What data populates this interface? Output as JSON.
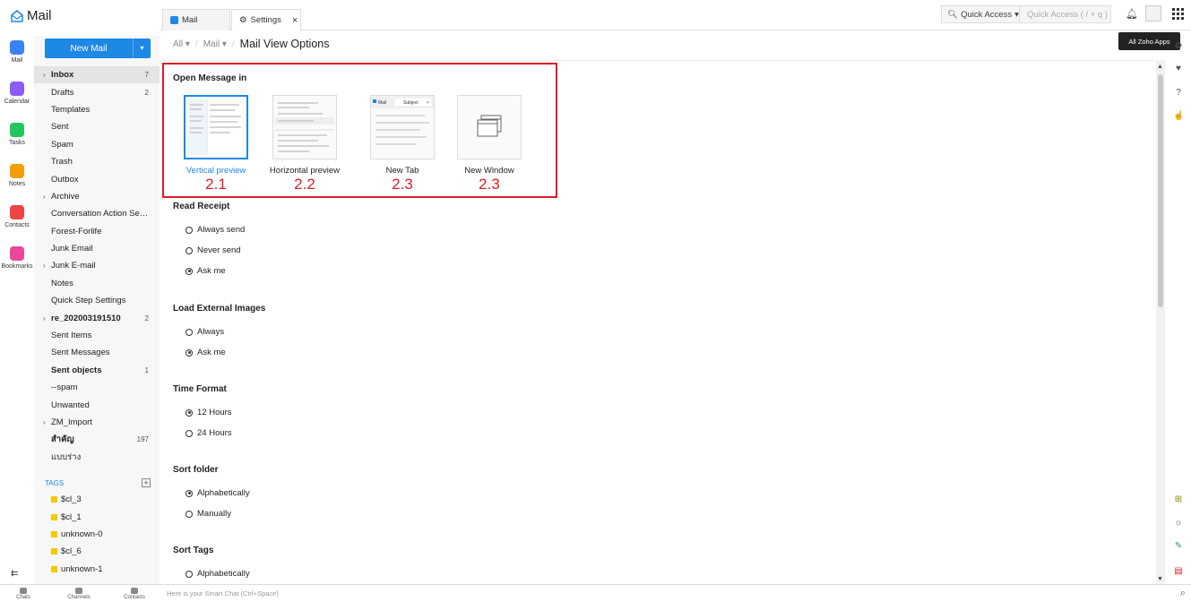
{
  "app": {
    "title": "Mail",
    "accent": "#1e88e5",
    "highlight": "#e01b24"
  },
  "rail": [
    {
      "label": "Mail",
      "icon": "mail-icon",
      "color": "#3b82f6"
    },
    {
      "label": "Calendar",
      "icon": "calendar-icon",
      "color": "#8b5cf6"
    },
    {
      "label": "Tasks",
      "icon": "tasks-icon",
      "color": "#22c55e"
    },
    {
      "label": "Notes",
      "icon": "notes-icon",
      "color": "#f59e0b"
    },
    {
      "label": "Contacts",
      "icon": "contacts-icon",
      "color": "#ef4444"
    },
    {
      "label": "Bookmarks",
      "icon": "bookmarks-icon",
      "color": "#ec4899"
    }
  ],
  "new_mail": {
    "label": "New Mail"
  },
  "folders": [
    {
      "label": "Inbox",
      "count": "7",
      "caret": "›",
      "bold": true,
      "selected": true
    },
    {
      "label": "Drafts",
      "count": "2",
      "caret": "",
      "bold": false,
      "selected": false
    },
    {
      "label": "Templates",
      "count": "",
      "caret": "",
      "bold": false,
      "selected": false
    },
    {
      "label": "Sent",
      "count": "",
      "caret": "",
      "bold": false,
      "selected": false
    },
    {
      "label": "Spam",
      "count": "",
      "caret": "",
      "bold": false,
      "selected": false
    },
    {
      "label": "Trash",
      "count": "",
      "caret": "",
      "bold": false,
      "selected": false
    },
    {
      "label": "Outbox",
      "count": "",
      "caret": "",
      "bold": false,
      "selected": false
    },
    {
      "label": "Archive",
      "count": "",
      "caret": "›",
      "bold": false,
      "selected": false
    },
    {
      "label": "Conversation Action Sett...",
      "count": "",
      "caret": "",
      "bold": false,
      "selected": false
    },
    {
      "label": "Forest-Forlife",
      "count": "",
      "caret": "",
      "bold": false,
      "selected": false
    },
    {
      "label": "Junk Email",
      "count": "",
      "caret": "",
      "bold": false,
      "selected": false
    },
    {
      "label": "Junk E-mail",
      "count": "",
      "caret": "›",
      "bold": false,
      "selected": false
    },
    {
      "label": "Notes",
      "count": "",
      "caret": "",
      "bold": false,
      "selected": false
    },
    {
      "label": "Quick Step Settings",
      "count": "",
      "caret": "",
      "bold": false,
      "selected": false
    },
    {
      "label": "re_202003191510",
      "count": "2",
      "caret": "›",
      "bold": true,
      "selected": false
    },
    {
      "label": "Sent Items",
      "count": "",
      "caret": "",
      "bold": false,
      "selected": false
    },
    {
      "label": "Sent Messages",
      "count": "",
      "caret": "",
      "bold": false,
      "selected": false
    },
    {
      "label": "Sent objects",
      "count": "1",
      "caret": "",
      "bold": true,
      "selected": false
    },
    {
      "label": "--spam",
      "count": "",
      "caret": "",
      "bold": false,
      "selected": false
    },
    {
      "label": "Unwanted",
      "count": "",
      "caret": "",
      "bold": false,
      "selected": false
    },
    {
      "label": "ZM_Import",
      "count": "",
      "caret": "›",
      "bold": false,
      "selected": false
    },
    {
      "label": "สำคัญ",
      "count": "197",
      "caret": "",
      "bold": true,
      "selected": false
    },
    {
      "label": "แบบร่าง",
      "count": "",
      "caret": "",
      "bold": false,
      "selected": false
    }
  ],
  "tags_header": "TAGS",
  "tags": [
    {
      "label": "$cl_3",
      "color": "#f5c800"
    },
    {
      "label": "$cl_1",
      "color": "#f5c800"
    },
    {
      "label": "unknown-0",
      "color": "#f5c800"
    },
    {
      "label": "$cl_6",
      "color": "#f5c800"
    },
    {
      "label": "unknown-1",
      "color": "#f5c800"
    }
  ],
  "bottom_bar": {
    "chats": "Chats",
    "channels": "Channels",
    "contacts": "Contacts",
    "smart_chat_placeholder": "Here is your Smart Chat (Ctrl+Space)"
  },
  "tabs": [
    {
      "label": "Mail",
      "icon": "mail-tab-icon"
    },
    {
      "label": "Settings",
      "icon": "gear-icon"
    }
  ],
  "quick_access": {
    "label": "Quick Access",
    "placeholder": "Quick Access  ( / + q )"
  },
  "tooltip": "All Zoho Apps",
  "breadcrumb": {
    "all": "All",
    "mail": "Mail",
    "current": "Mail View Options"
  },
  "open_message": {
    "title": "Open Message in",
    "options": [
      {
        "label": "Vertical preview",
        "number": "2.1",
        "selected": true
      },
      {
        "label": "Horizontal preview",
        "number": "2.2",
        "selected": false
      },
      {
        "label": "New Tab",
        "number": "2.3",
        "selected": false
      },
      {
        "label": "New Window",
        "number": "2.3",
        "selected": false
      }
    ],
    "newtab_thumb": {
      "mail": "Mail",
      "subject": "Subject"
    }
  },
  "sections": [
    {
      "title": "Read Receipt",
      "options": [
        {
          "label": "Always send",
          "checked": false
        },
        {
          "label": "Never send",
          "checked": false
        },
        {
          "label": "Ask me",
          "checked": true
        }
      ]
    },
    {
      "title": "Load External Images",
      "options": [
        {
          "label": "Always",
          "checked": false
        },
        {
          "label": "Ask me",
          "checked": true
        }
      ]
    },
    {
      "title": "Time Format",
      "options": [
        {
          "label": "12 Hours",
          "checked": true
        },
        {
          "label": "24 Hours",
          "checked": false
        }
      ]
    },
    {
      "title": "Sort folder",
      "options": [
        {
          "label": "Alphabetically",
          "checked": true
        },
        {
          "label": "Manually",
          "checked": false
        }
      ]
    },
    {
      "title": "Sort Tags",
      "options": [
        {
          "label": "Alphabetically",
          "checked": false
        }
      ]
    }
  ]
}
